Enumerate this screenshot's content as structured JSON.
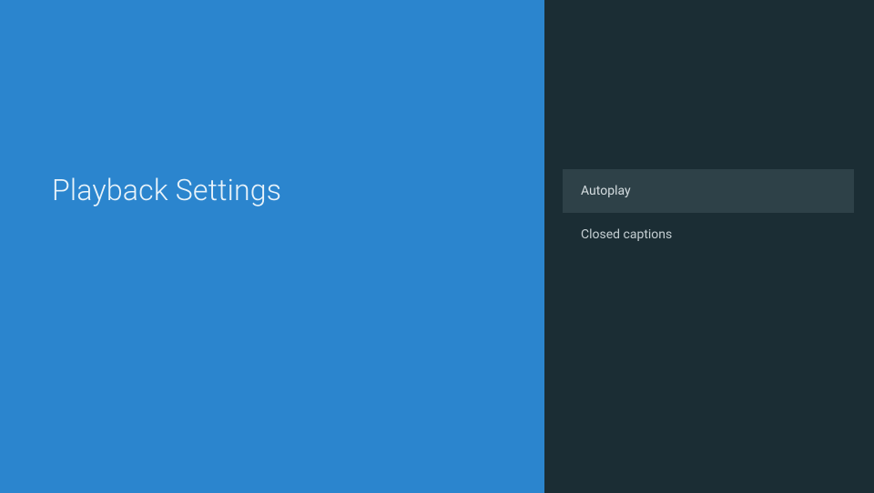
{
  "header": {
    "title": "Playback Settings"
  },
  "menu": {
    "items": [
      {
        "label": "Autoplay",
        "highlighted": true
      },
      {
        "label": "Closed captions",
        "highlighted": false
      }
    ]
  },
  "colors": {
    "left_panel_bg": "#2b85ce",
    "right_panel_bg": "#1b2d34",
    "highlight_bg": "#2e4148",
    "title_color": "#e8f3fa",
    "text_color": "#c5cfd3"
  }
}
